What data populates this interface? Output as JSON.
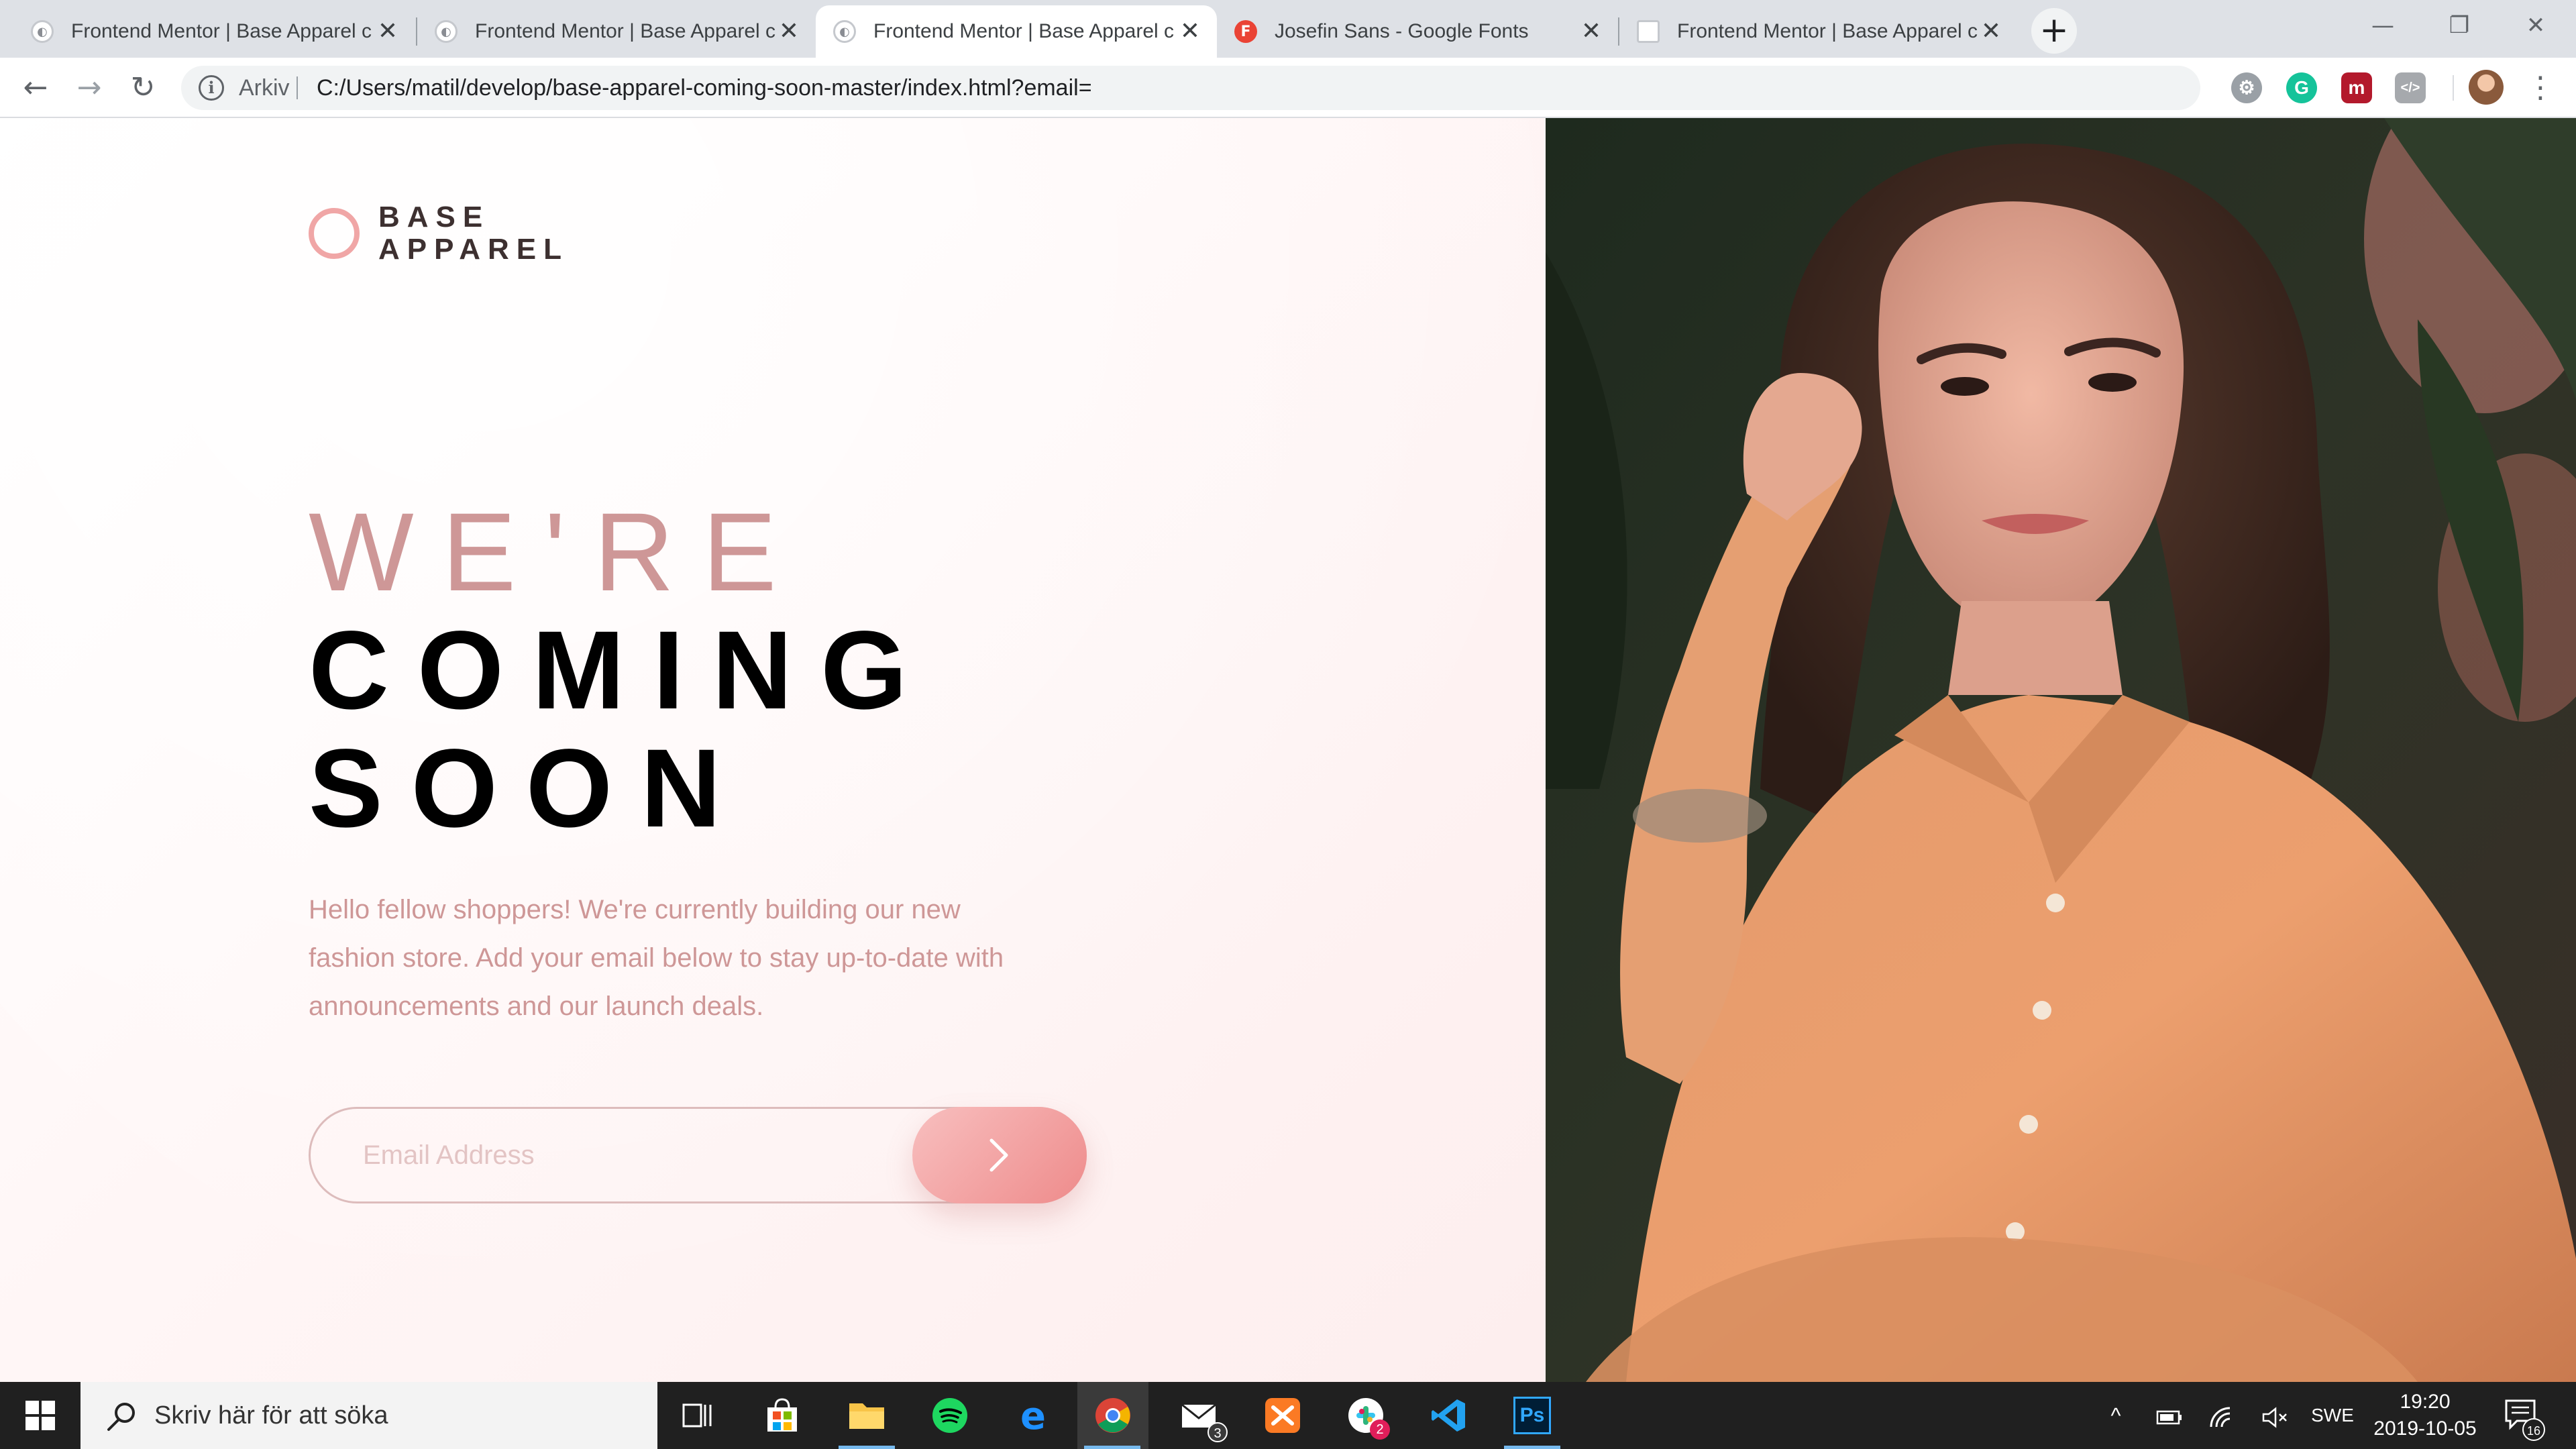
{
  "browser": {
    "tabs": [
      {
        "title": "Frontend Mentor | Base Apparel c",
        "favicon": "frontend-mentor-icon",
        "active": false
      },
      {
        "title": "Frontend Mentor | Base Apparel c",
        "favicon": "frontend-mentor-icon",
        "active": false
      },
      {
        "title": "Frontend Mentor | Base Apparel c",
        "favicon": "frontend-mentor-icon",
        "active": true
      },
      {
        "title": "Josefin Sans - Google Fonts",
        "favicon": "google-fonts-icon",
        "favicon_letter": "F",
        "active": false
      },
      {
        "title": "Frontend Mentor | Base Apparel c",
        "favicon": "document-icon",
        "active": false
      }
    ],
    "tab_close_glyph": "✕",
    "new_tab_glyph": "+",
    "window_controls": {
      "minimize": "—",
      "restore": "❐",
      "close": "✕"
    },
    "toolbar": {
      "back": "←",
      "forward": "→",
      "reload": "↻",
      "info_glyph": "i",
      "scheme_label": "Arkiv",
      "url": "C:/Users/matil/develop/base-apparel-coming-soon-master/index.html?email=",
      "bookmark_glyph": "☆",
      "menu_glyph": "⋮",
      "extensions": [
        {
          "name": "settings-extension-icon",
          "glyph": "⚙"
        },
        {
          "name": "grammarly-extension-icon",
          "glyph": "G"
        },
        {
          "name": "red-extension-icon",
          "glyph": "m"
        },
        {
          "name": "code-extension-icon",
          "glyph": "</>"
        }
      ]
    }
  },
  "page": {
    "logo": {
      "line1": "BASE",
      "line2": "APPAREL"
    },
    "headline": {
      "light": "WE'RE",
      "bold1": "COMING",
      "bold2": "SOON"
    },
    "intro_lines": [
      "Hello fellow shoppers! We're currently building our new",
      "fashion store. Add your email below to stay up-to-date with",
      "announcements and our launch deals."
    ],
    "email_placeholder": "Email Address",
    "hero_image": "woman-in-orange-shirt-photo",
    "colors": {
      "accent_pink": "#ce9797",
      "button_from": "#f8bfbf",
      "button_to": "#ee8b8b",
      "headline_dark": "#000000"
    }
  },
  "taskbar": {
    "search_placeholder": "Skriv här för att söka",
    "apps": [
      {
        "name": "task-view-icon"
      },
      {
        "name": "microsoft-store-icon"
      },
      {
        "name": "file-explorer-icon"
      },
      {
        "name": "spotify-icon"
      },
      {
        "name": "edge-icon"
      },
      {
        "name": "chrome-icon",
        "active": true
      },
      {
        "name": "mail-icon",
        "badge": "3"
      },
      {
        "name": "xampp-icon"
      },
      {
        "name": "slack-icon",
        "badge": "2"
      },
      {
        "name": "vscode-icon"
      },
      {
        "name": "photoshop-icon",
        "label": "Ps"
      }
    ],
    "tray": {
      "chevron": "^",
      "language": "SWE"
    },
    "clock": {
      "time": "19:20",
      "date": "2019-10-05"
    },
    "notification_count": "16"
  }
}
